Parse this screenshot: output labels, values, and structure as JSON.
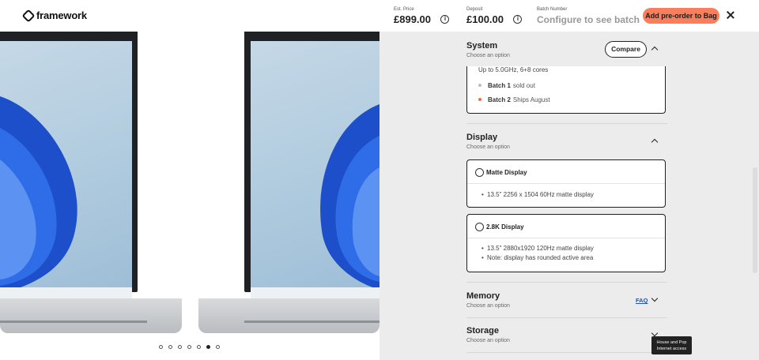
{
  "brand": {
    "name": "framework"
  },
  "header": {
    "est_price_label": "Est. Price",
    "est_price": "£899.00",
    "deposit_label": "Deposit",
    "deposit": "£100.00",
    "batch_label": "Batch Number",
    "batch_value": "Configure to see batch",
    "cta_label": "Add pre-order to Bag",
    "accent_color": "#f97e5b"
  },
  "gallery": {
    "dots_count": 7,
    "active_dot_index": 5
  },
  "system": {
    "title": "System",
    "subtitle": "Choose an option",
    "compare_label": "Compare",
    "speed_text": "Up to 5.0GHz, 6+8 cores",
    "batches": [
      {
        "name": "Batch 1",
        "status": "sold out",
        "color": "#bdbdbd"
      },
      {
        "name": "Batch 2",
        "status": "Ships August",
        "color": "#f06a3f"
      }
    ]
  },
  "display": {
    "title": "Display",
    "subtitle": "Choose an option",
    "options": [
      {
        "title": "Matte Display",
        "specs": [
          "13.5\" 2256 x 1504 60Hz matte display"
        ]
      },
      {
        "title": "2.8K Display",
        "specs": [
          "13.5\" 2880x1920 120Hz matte display",
          "Note: display has rounded active area"
        ]
      }
    ]
  },
  "memory": {
    "title": "Memory",
    "subtitle": "Choose an option",
    "faq_label": "FAQ"
  },
  "storage": {
    "title": "Storage",
    "subtitle": "Choose an option"
  },
  "tooltip": {
    "line1": "House and Pop",
    "line2": "Internet access"
  }
}
